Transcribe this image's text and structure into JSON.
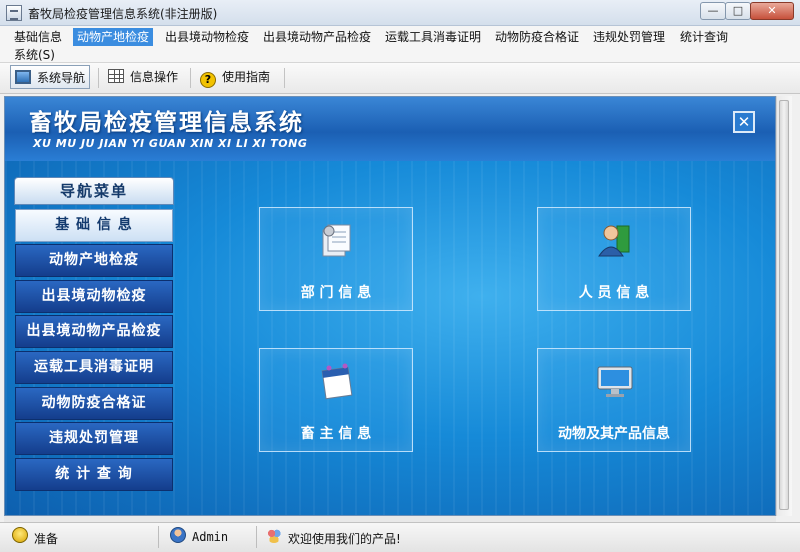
{
  "window": {
    "title": "畜牧局检疫管理信息系统(非注册版)",
    "buttons": {
      "minimize": "—",
      "maximize": "□",
      "close": "✕"
    }
  },
  "menu": {
    "items": [
      "基础信息",
      "动物产地检疫",
      "出县境动物检疫",
      "出县境动物产品检疫",
      "运载工具消毒证明",
      "动物防疫合格证",
      "违规处罚管理",
      "统计查询",
      "系统(S)"
    ],
    "active_index": 1
  },
  "toolbar": {
    "items": [
      {
        "label": "系统导航",
        "icon": "monitor-icon",
        "active": true
      },
      {
        "label": "信息操作",
        "icon": "grid-icon",
        "active": false
      },
      {
        "label": "使用指南",
        "icon": "help-icon",
        "active": false
      }
    ]
  },
  "banner": {
    "title_cn": "畜牧局检疫管理信息系统",
    "title_pinyin": "XU MU JU JIAN YI GUAN  XIN XI LI XI TONG",
    "close_glyph": "✕"
  },
  "nav": {
    "header": "导航菜单",
    "items": [
      "基 础 信 息",
      "动物产地检疫",
      "出县境动物检疫",
      "出县境动物产品检疫",
      "运载工具消毒证明",
      "动物防疫合格证",
      "违规处罚管理",
      "统 计 查 询"
    ]
  },
  "tiles": [
    {
      "label": "部 门 信 息",
      "icon": "documents-icon"
    },
    {
      "label": "人 员 信 息",
      "icon": "user-icon"
    },
    {
      "label": "畜 主 信 息",
      "icon": "notepad-icon"
    },
    {
      "label": "动物及其产品信息",
      "icon": "monitor-icon"
    }
  ],
  "status": {
    "state": "准备",
    "user": "Admin",
    "message": "欢迎使用我们的产品!"
  },
  "colors": {
    "accent": "#3b8de0",
    "banner": "#1b5fb3",
    "nav_item": "#143d8c"
  }
}
